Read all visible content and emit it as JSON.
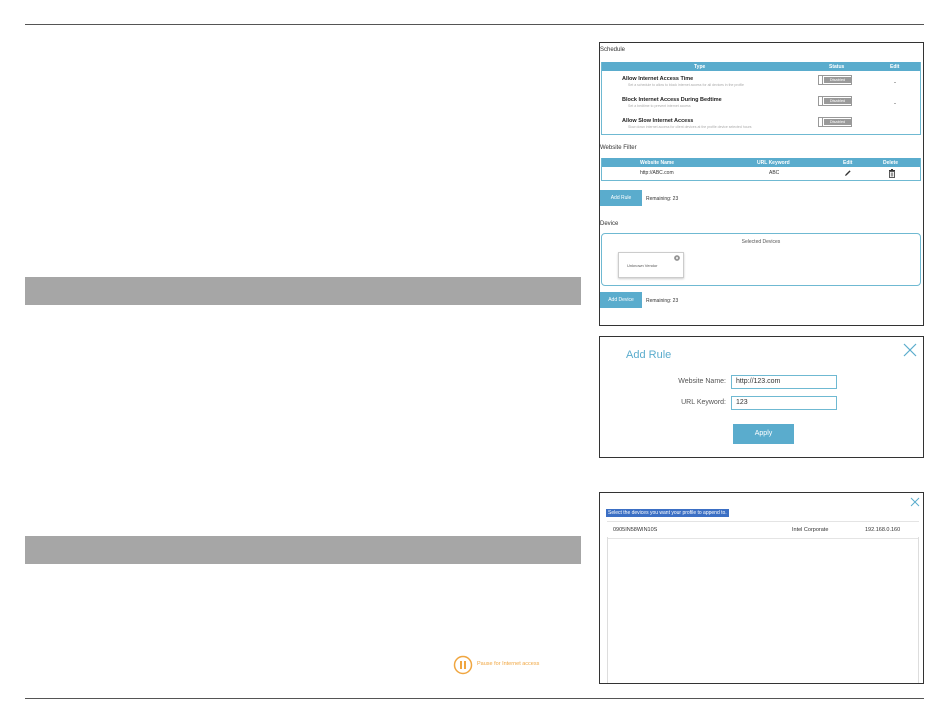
{
  "schedule": {
    "section_label": "Schedule",
    "columns": [
      "Type",
      "Status",
      "Edit"
    ],
    "rows": [
      {
        "title": "Allow Internet Access Time",
        "subtitle": "Set a schedule to allow to block internet access for all devices in the profile",
        "status": "Disabled",
        "edit": "-"
      },
      {
        "title": "Block Internet Access During Bedtime",
        "subtitle": "Set a bedtime to prevent internet access",
        "status": "Disabled",
        "edit": "-"
      },
      {
        "title": "Allow Slow Internet Access",
        "subtitle": "Slow down internet access for client devices at the profile device selected hours",
        "status": "Disabled",
        "edit": ""
      }
    ]
  },
  "website_filter": {
    "section_label": "Website Filter",
    "columns": [
      "Website Name",
      "URL Keyword",
      "Edit",
      "Delete"
    ],
    "rows": [
      {
        "website_name": "http://ABC.com",
        "url_keyword": "ABC"
      }
    ],
    "add_rule_label": "Add Rule",
    "remaining": "Remaining: 23"
  },
  "device": {
    "section_label": "Device",
    "selected_devices_label": "Selected Devices",
    "card_name": "Unknown Vendor",
    "add_device_label": "Add Device",
    "remaining": "Remaining: 23"
  },
  "add_rule_dialog": {
    "title": "Add Rule",
    "website_name_label": "Website Name:",
    "website_name_value": "http://123.com",
    "url_keyword_label": "URL Keyword:",
    "url_keyword_value": "123",
    "apply_label": "Apply"
  },
  "select_devices_dialog": {
    "hint": "Select the devices you want your profile to append to.",
    "devices": [
      {
        "name": "0905IN58WIN10S",
        "vendor": "Intel Corporate",
        "ip": "192.168.0.160"
      }
    ]
  },
  "pause": {
    "label": "Pause for Internet access",
    "color": "#f0a640"
  },
  "colors": {
    "accent": "#5aaccd",
    "toggle_gray": "#9a9a9a",
    "band_gray": "#a6a6a6"
  }
}
